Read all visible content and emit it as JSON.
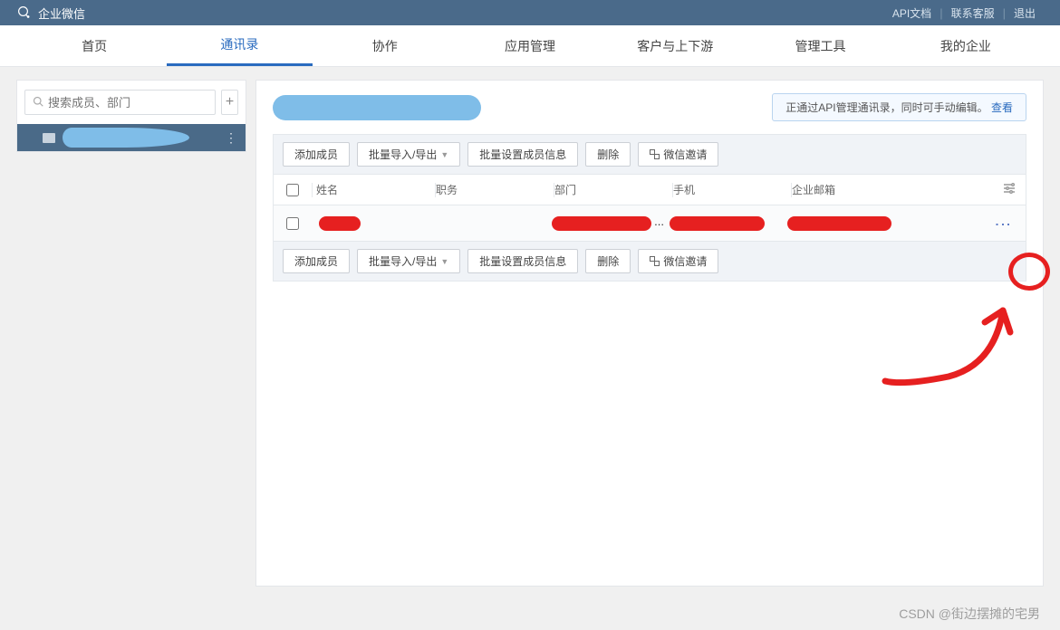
{
  "app_name": "企业微信",
  "topbar_links": [
    "API文档",
    "联系客服",
    "退出"
  ],
  "nav_items": [
    "首页",
    "通讯录",
    "协作",
    "应用管理",
    "客户与上下游",
    "管理工具",
    "我的企业"
  ],
  "active_nav_index": 1,
  "search_placeholder": "搜索成员、部门",
  "notice": {
    "text": "正通过API管理通讯录，同时可手动编辑。",
    "link": "查看"
  },
  "toolbar_buttons": {
    "add_member": "添加成员",
    "batch_import": "批量导入/导出",
    "batch_set": "批量设置成员信息",
    "delete": "删除",
    "wechat_invite": "微信邀请"
  },
  "table_headers": {
    "name": "姓名",
    "job": "职务",
    "dept": "部门",
    "phone": "手机",
    "email": "企业邮箱"
  },
  "watermark": "CSDN @街边摆摊的宅男",
  "annotation_color": "#e62020"
}
